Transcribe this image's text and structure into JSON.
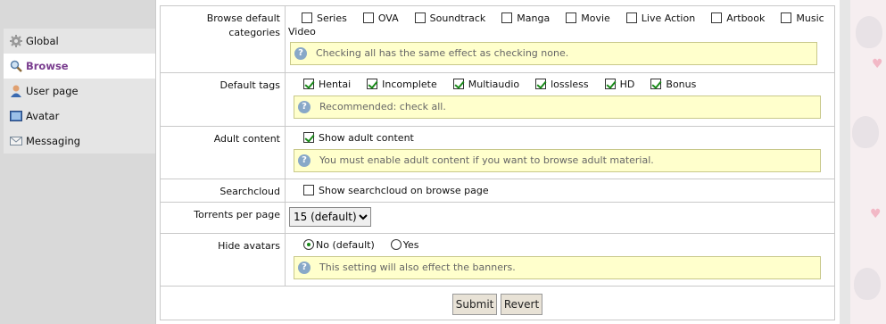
{
  "sidebar": {
    "items": [
      {
        "label": "Global",
        "icon": "gear-icon"
      },
      {
        "label": "Browse",
        "icon": "magnifier-icon",
        "active": true
      },
      {
        "label": "User page",
        "icon": "user-icon"
      },
      {
        "label": "Avatar",
        "icon": "avatar-icon"
      },
      {
        "label": "Messaging",
        "icon": "envelope-icon"
      }
    ]
  },
  "settings": {
    "browse_categories": {
      "label": "Browse default categories",
      "options": [
        {
          "label": "Series",
          "checked": false
        },
        {
          "label": "OVA",
          "checked": false
        },
        {
          "label": "Soundtrack",
          "checked": false
        },
        {
          "label": "Manga",
          "checked": false
        },
        {
          "label": "Movie",
          "checked": false
        },
        {
          "label": "Live Action",
          "checked": false
        },
        {
          "label": "Artbook",
          "checked": false
        },
        {
          "label": "Music",
          "checked": false
        },
        {
          "label": "Video",
          "checked": false
        }
      ],
      "note": "Checking all has the same effect as checking none."
    },
    "default_tags": {
      "label": "Default tags",
      "options": [
        {
          "label": "Hentai",
          "checked": true
        },
        {
          "label": "Incomplete",
          "checked": true
        },
        {
          "label": "Multiaudio",
          "checked": true
        },
        {
          "label": "lossless",
          "checked": true
        },
        {
          "label": "HD",
          "checked": true
        },
        {
          "label": "Bonus",
          "checked": true
        }
      ],
      "note": "Recommended: check all."
    },
    "adult_content": {
      "label": "Adult content",
      "option": "Show adult content",
      "checked": true,
      "note": "You must enable adult content if you want to browse adult material."
    },
    "searchcloud": {
      "label": "Searchcloud",
      "option": "Show searchcloud on browse page",
      "checked": false
    },
    "torrents_per_page": {
      "label": "Torrents per page",
      "selected": "15 (default)"
    },
    "hide_avatars": {
      "label": "Hide avatars",
      "options": [
        {
          "label": "No (default)",
          "selected": true
        },
        {
          "label": "Yes",
          "selected": false
        }
      ],
      "note": "This setting will also effect the banners."
    }
  },
  "buttons": {
    "submit": "Submit",
    "revert": "Revert"
  },
  "colors": {
    "note_bg": "#ffffcc",
    "active_sidebar_text": "#7a3d8f",
    "check_color": "#1a8a1a"
  }
}
